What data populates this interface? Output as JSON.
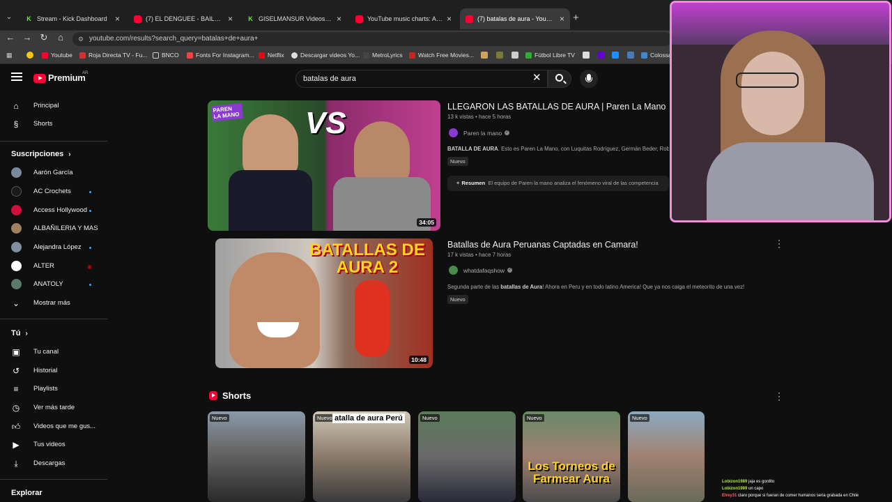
{
  "browser": {
    "tabs": [
      {
        "title": "Stream - Kick Dashboard",
        "icon": "kick-icon"
      },
      {
        "title": "(7) EL DENGUEE - BAILA APRET",
        "icon": "youtube-icon"
      },
      {
        "title": "GISELMANSUR Videos - Watch",
        "icon": "kick-icon"
      },
      {
        "title": "YouTube music charts: Argentin",
        "icon": "youtube-icon"
      },
      {
        "title": "(7) batalas de aura - YouTub",
        "icon": "youtube-icon"
      }
    ],
    "url": "youtube.com/results?search_query=batalas+de+aura+",
    "bookmarks": [
      "Youtube",
      "Roja Directa TV - Fu...",
      "BNCO",
      "Fonts For Instagram...",
      "Netflix",
      "Descargar videos Yo...",
      "MetroLyrics",
      "Watch Free Movies...",
      "Fútbol Libre TV",
      "Colossa"
    ]
  },
  "header": {
    "logo_text": "Premium",
    "country_code": "AR",
    "search_value": "batalas de aura"
  },
  "sidebar": {
    "main": [
      {
        "label": "Principal",
        "icon": "home-icon"
      },
      {
        "label": "Shorts",
        "icon": "shorts-icon"
      }
    ],
    "subs_title": "Suscripciones",
    "subs": [
      {
        "label": "Aarón García"
      },
      {
        "label": "AC Crochets"
      },
      {
        "label": "Access Hollywood"
      },
      {
        "label": "ALBAÑILERIA Y MAS"
      },
      {
        "label": "Alejandra López"
      },
      {
        "label": "ALTER"
      },
      {
        "label": "ANATOLY"
      }
    ],
    "show_more": "Mostrar más",
    "you_title": "Tú",
    "you": [
      {
        "label": "Tu canal",
        "icon": "channel-icon"
      },
      {
        "label": "Historial",
        "icon": "history-icon"
      },
      {
        "label": "Playlists",
        "icon": "playlist-icon"
      },
      {
        "label": "Ver más tarde",
        "icon": "clock-icon"
      },
      {
        "label": "Videos que me gus...",
        "icon": "thumbs-up-icon"
      },
      {
        "label": "Tus videos",
        "icon": "video-icon"
      },
      {
        "label": "Descargas",
        "icon": "download-icon"
      }
    ],
    "explore_title": "Explorar"
  },
  "results": [
    {
      "title": "LLEGARON LAS BATALLAS DE AURA | Paren La Mano",
      "meta": "13 k vistas • hace 5 horas",
      "channel": "Paren la mano",
      "desc_bold": "BATALLA DE AURA",
      "desc_rest": ". Esto es Paren La Mano, con Luquitas Rodríguez, Germán Beder, Rober",
      "badge": "Nuevo",
      "duration": "34:05",
      "thumb_text": "VS",
      "thumb_tag": "PAREN LA MANO",
      "summary_label": "Resumen",
      "summary_text": "El equipo de Paren la mano analiza el fenómeno viral de las competencia"
    },
    {
      "title": "Batallas de Aura Peruanas Captadas en Camara!",
      "meta": "17 k vistas • hace 7 horas",
      "channel": "whatdafaqshow",
      "desc_pre": "Segunda parte de las ",
      "desc_bold": "batallas de Aura",
      "desc_rest": "! Ahora en Peru y en todo latino America! Que ya nos caiga el meteorito de una vez!",
      "badge": "Nuevo",
      "duration": "10:48",
      "thumb_text": "BATALLAS DE AURA 2"
    }
  ],
  "shorts": {
    "title": "Shorts",
    "items": [
      {
        "badge": "Nuevo",
        "caption": ""
      },
      {
        "badge": "Nuevo",
        "caption": "atalla de aura Perú"
      },
      {
        "badge": "Nuevo",
        "caption": ""
      },
      {
        "badge": "Nuevo",
        "caption": "Los Torneos de Farmear Aura"
      },
      {
        "badge": "Nuevo",
        "caption": ""
      }
    ]
  },
  "chat": [
    {
      "user": "Lobizon1989",
      "msg": "jaja es gordito"
    },
    {
      "user": "Lobizon1989",
      "msg": "un capo"
    },
    {
      "user": "Elrey31",
      "msg": "claro porque si fueran de comer humanos seria grabada en Chile"
    }
  ]
}
